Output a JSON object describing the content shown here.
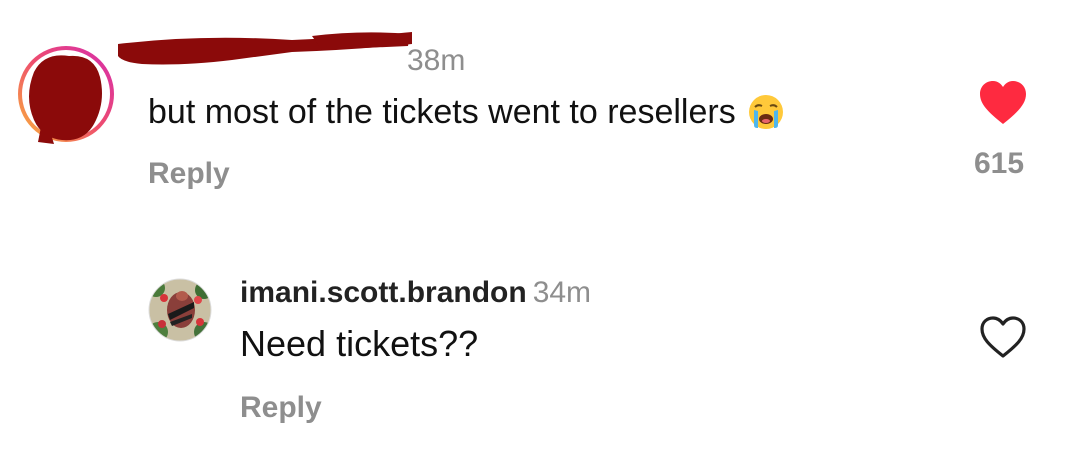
{
  "comments": [
    {
      "time": "38m",
      "text": "but most of the tickets went to resellers",
      "emoji": "loudly-crying-face",
      "reply_label": "Reply",
      "liked": true,
      "like_count": "615"
    }
  ],
  "reply": {
    "username": "imani.scott.brandon",
    "time": "34m",
    "text": "Need tickets??",
    "reply_label": "Reply",
    "liked": false
  },
  "colors": {
    "liked_heart": "#fe2a40",
    "muted_text": "#8e8e8e",
    "redaction": "#8b0a0a",
    "story_ring_start": "#f9b33a",
    "story_ring_end": "#d62dac"
  }
}
